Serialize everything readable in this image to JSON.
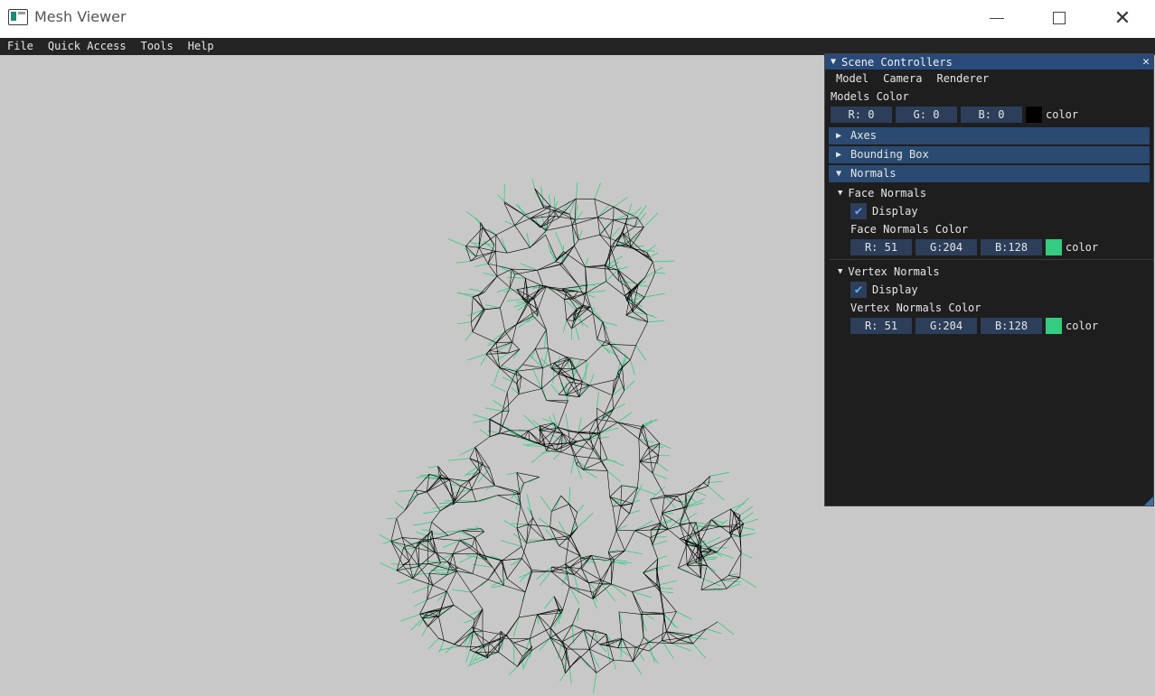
{
  "window": {
    "title": "Mesh Viewer"
  },
  "menu": {
    "items": [
      "File",
      "Quick Access",
      "Tools",
      "Help"
    ]
  },
  "panel": {
    "title": "Scene Controllers",
    "tabs": [
      "Model",
      "Camera",
      "Renderer"
    ],
    "models_color": {
      "label": "Models Color",
      "r": "R:  0",
      "g": "G:  0",
      "b": "B:  0",
      "swatch": "#000000",
      "swatch_label": "color"
    },
    "sections": [
      "Axes",
      "Bounding Box",
      "Normals"
    ],
    "face_normals": {
      "title": "Face Normals",
      "display_label": "Display",
      "color_label": "Face Normals Color",
      "r": "R: 51",
      "g": "G:204",
      "b": "B:128",
      "swatch": "#33cc80",
      "swatch_label": "color"
    },
    "vertex_normals": {
      "title": "Vertex Normals",
      "display_label": "Display",
      "color_label": "Vertex Normals Color",
      "r": "R: 51",
      "g": "G:204",
      "b": "B:128",
      "swatch": "#33cc80",
      "swatch_label": "color"
    }
  },
  "colors": {
    "viewport_bg": "#c8c8c8",
    "wireframe": "#000000",
    "normals": "#33cc80",
    "panel_title": "#294a7a",
    "section_header": "#2a4a72"
  }
}
